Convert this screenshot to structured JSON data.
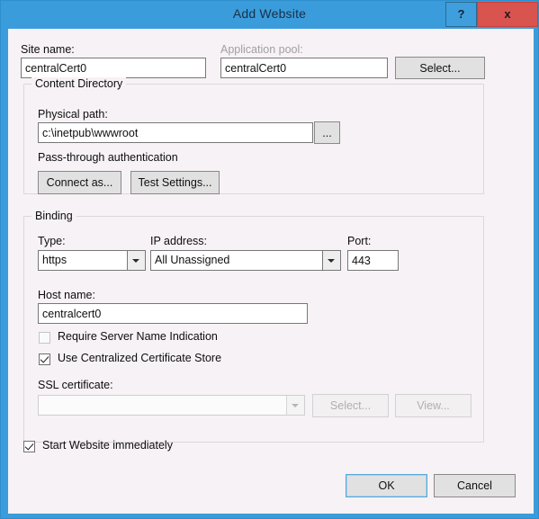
{
  "titlebar": {
    "title": "Add Website",
    "help_label": "?",
    "close_label": "x",
    "bar_color": "#3b9cdb",
    "close_color": "#d9534f"
  },
  "form": {
    "site_name": {
      "label": "Site name:",
      "value": "centralCert0"
    },
    "application_pool": {
      "label": "Application pool:",
      "value": "centralCert0",
      "select_button": "Select..."
    }
  },
  "content_directory": {
    "group_title": "Content Directory",
    "physical_path": {
      "label": "Physical path:",
      "value": "c:\\inetpub\\wwwroot",
      "browse_button": "..."
    },
    "passthrough_label": "Pass-through authentication",
    "connect_as_button": "Connect as...",
    "test_settings_button": "Test Settings..."
  },
  "binding": {
    "group_title": "Binding",
    "type": {
      "label": "Type:",
      "value": "https"
    },
    "ip_address": {
      "label": "IP address:",
      "value": "All Unassigned"
    },
    "port": {
      "label": "Port:",
      "value": "443"
    },
    "host_name": {
      "label": "Host name:",
      "value": "centralcert0"
    },
    "require_sni": {
      "label": "Require Server Name Indication",
      "checked": false
    },
    "use_ccs": {
      "label": "Use Centralized Certificate Store",
      "checked": true
    },
    "ssl_certificate": {
      "label": "SSL certificate:",
      "value": "",
      "select_button": "Select...",
      "view_button": "View..."
    }
  },
  "start_website": {
    "label": "Start Website immediately",
    "checked": true
  },
  "footer": {
    "ok_button": "OK",
    "cancel_button": "Cancel"
  }
}
